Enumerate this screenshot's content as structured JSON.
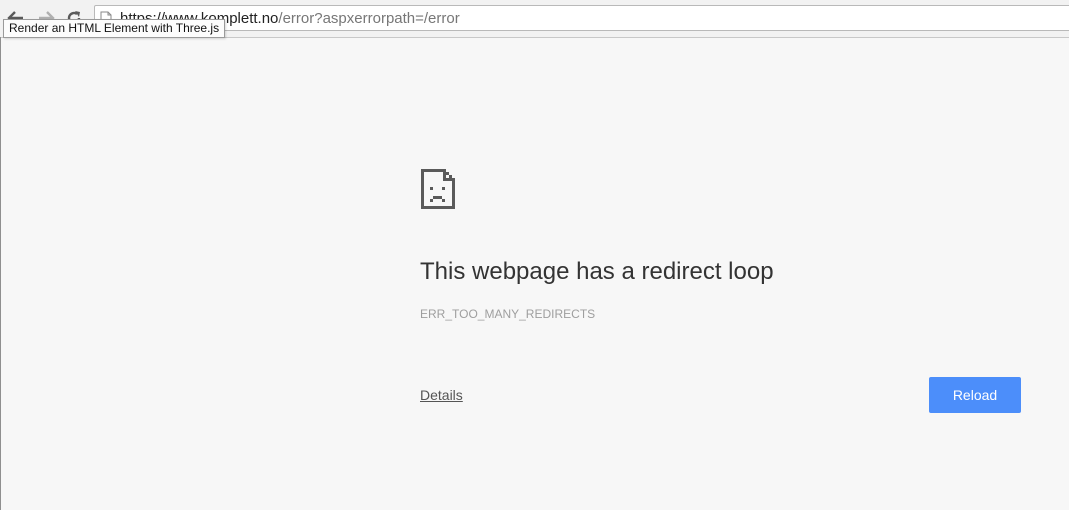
{
  "browser": {
    "address_bar": {
      "url_scheme_host": "https://www.komplett.no",
      "url_path": "/error?aspxerrorpath=/error"
    },
    "tooltip": "Render an HTML Element with Three.js"
  },
  "error_page": {
    "icon": "sad-page-icon",
    "title": "This webpage has a redirect loop",
    "code": "ERR_TOO_MANY_REDIRECTS",
    "details_label": "Details",
    "reload_label": "Reload",
    "accent_color": "#4c8efa"
  }
}
